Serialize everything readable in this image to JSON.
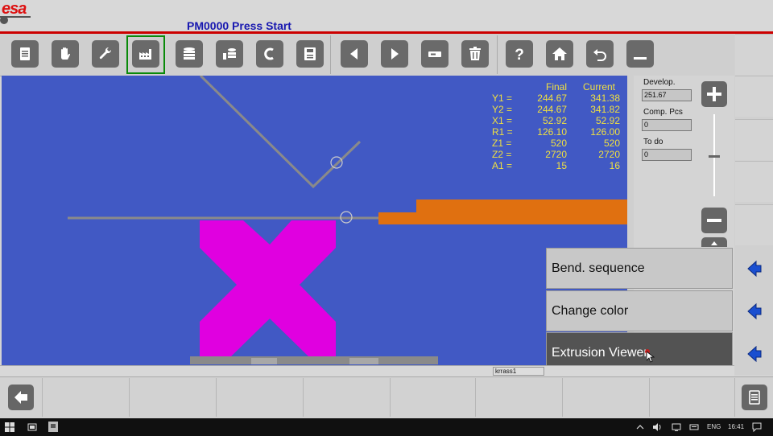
{
  "app": {
    "logo": "esa",
    "title": "PM0000 Press Start"
  },
  "toolbar": {
    "buttons": [
      "document",
      "hand",
      "wrench",
      "factory",
      "database-stack",
      "database-split",
      "c-mode",
      "save",
      "prev",
      "next",
      "minus-box",
      "trash",
      "help",
      "home",
      "undo",
      "minimize"
    ],
    "active": "factory"
  },
  "values": {
    "header_final": "Final",
    "header_current": "Current",
    "rows": [
      {
        "label": "Y1 =",
        "final": "244.67",
        "current": "341.38"
      },
      {
        "label": "Y2 =",
        "final": "244.67",
        "current": "341.82"
      },
      {
        "label": "X1 =",
        "final": "52.92",
        "current": "52.92"
      },
      {
        "label": "R1 =",
        "final": "126.10",
        "current": "126.00"
      },
      {
        "label": "Z1 =",
        "final": "520",
        "current": "520"
      },
      {
        "label": "Z2 =",
        "final": "2720",
        "current": "2720"
      },
      {
        "label": "A1 =",
        "final": "15",
        "current": "16"
      }
    ]
  },
  "panel": {
    "develop_label": "Develop.",
    "develop_value": "251.67",
    "comp_label": "Comp. Pcs",
    "comp_value": "0",
    "todo_label": "To do",
    "todo_value": "0"
  },
  "menu": {
    "items": [
      "Bend. sequence",
      "Change color",
      "Extrusion Viewer"
    ],
    "selected": "Extrusion Viewer"
  },
  "status": {
    "cell": "krrass1"
  },
  "taskbar": {
    "lang": "ENG",
    "time": "16:41"
  },
  "colors": {
    "canvas": "#4159c4",
    "values": "#f0e040",
    "tool": "#e000e0",
    "workpiece": "#e07010",
    "title": "#1818b0",
    "accent_red": "#cc0000"
  }
}
